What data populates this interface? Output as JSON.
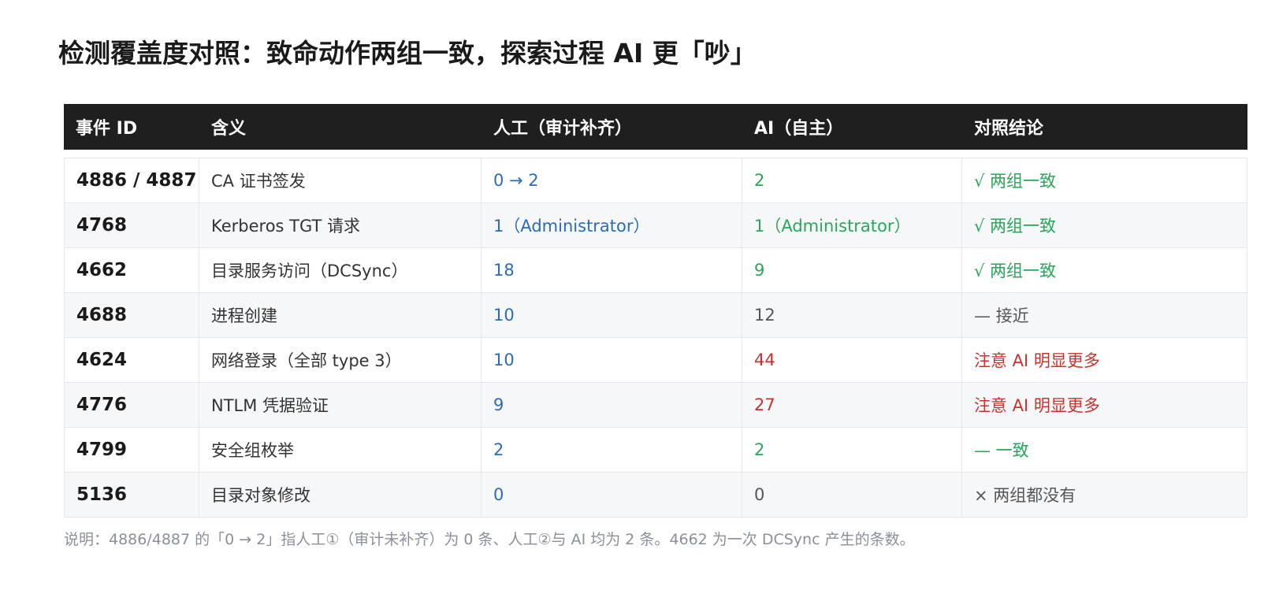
{
  "title": "检测覆盖度对照：致命动作两组一致，探索过程 AI 更「吵」",
  "colors": {
    "header_bg": "#1f1f1f",
    "blue": "#2c6cb5",
    "green": "#2aa55a",
    "red": "#c8322d",
    "gray": "#555555"
  },
  "table": {
    "headers": [
      "事件 ID",
      "含义",
      "人工（审计补齐）",
      "AI（自主）",
      "对照结论"
    ],
    "rows": [
      {
        "id": "4886 / 4887",
        "meaning": "CA 证书签发",
        "manual": "0 → 2",
        "ai": "2",
        "ai_color": "green",
        "conclusion": "√ 两组一致",
        "conclusion_color": "green"
      },
      {
        "id": "4768",
        "meaning": "Kerberos TGT 请求",
        "manual": "1（Administrator）",
        "ai": "1（Administrator）",
        "ai_color": "green",
        "conclusion": "√ 两组一致",
        "conclusion_color": "green"
      },
      {
        "id": "4662",
        "meaning": "目录服务访问（DCSync）",
        "manual": "18",
        "ai": "9",
        "ai_color": "green",
        "conclusion": "√ 两组一致",
        "conclusion_color": "green"
      },
      {
        "id": "4688",
        "meaning": "进程创建",
        "manual": "10",
        "ai": "12",
        "ai_color": "gray",
        "conclusion": "— 接近",
        "conclusion_color": "gray"
      },
      {
        "id": "4624",
        "meaning": "网络登录（全部 type 3）",
        "manual": "10",
        "ai": "44",
        "ai_color": "red",
        "conclusion": "注意  AI 明显更多",
        "conclusion_color": "red"
      },
      {
        "id": "4776",
        "meaning": "NTLM 凭据验证",
        "manual": "9",
        "ai": "27",
        "ai_color": "red",
        "conclusion": "注意  AI 明显更多",
        "conclusion_color": "red"
      },
      {
        "id": "4799",
        "meaning": "安全组枚举",
        "manual": "2",
        "ai": "2",
        "ai_color": "green",
        "conclusion": "— 一致",
        "conclusion_color": "green"
      },
      {
        "id": "5136",
        "meaning": "目录对象修改",
        "manual": "0",
        "ai": "0",
        "ai_color": "gray",
        "conclusion": "× 两组都没有",
        "conclusion_color": "gray"
      }
    ]
  },
  "footnote": "说明：4886/4887 的「0 → 2」指人工①（审计未补齐）为 0 条、人工②与 AI 均为 2 条。4662 为一次 DCSync 产生的条数。"
}
